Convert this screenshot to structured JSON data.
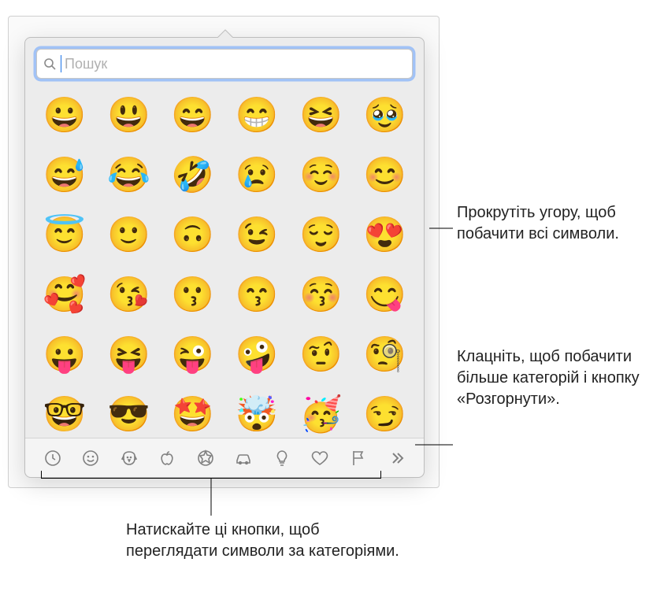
{
  "search": {
    "placeholder": "Пошук"
  },
  "emoji": {
    "rows": [
      [
        "😀",
        "😃",
        "😄",
        "😁",
        "😆",
        "🥹"
      ],
      [
        "😅",
        "😂",
        "🤣",
        "😢",
        "☺️",
        "😊"
      ],
      [
        "😇",
        "🙂",
        "🙃",
        "😉",
        "😌",
        "😍"
      ],
      [
        "🥰",
        "😘",
        "😗",
        "😙",
        "😚",
        "😋"
      ],
      [
        "😛",
        "😝",
        "😜",
        "🤪",
        "🤨",
        "🧐"
      ],
      [
        "🤓",
        "😎",
        "🤩",
        "🤯",
        "🥳",
        "😏"
      ]
    ]
  },
  "categories": [
    {
      "name": "recent",
      "icon": "clock"
    },
    {
      "name": "smileys",
      "icon": "smiley"
    },
    {
      "name": "animals",
      "icon": "dog"
    },
    {
      "name": "food",
      "icon": "apple"
    },
    {
      "name": "activity",
      "icon": "soccer"
    },
    {
      "name": "travel",
      "icon": "car"
    },
    {
      "name": "objects",
      "icon": "bulb"
    },
    {
      "name": "symbols",
      "icon": "heart"
    },
    {
      "name": "flags",
      "icon": "flag"
    },
    {
      "name": "more",
      "icon": "chevrons"
    }
  ],
  "callouts": {
    "scroll": "Прокрутіть угору, щоб побачити всі символи.",
    "expand": "Клацніть, щоб побачити більше категорій і кнопку «Розгорнути».",
    "categories": "Натискайте ці кнопки, щоб переглядати символи за категоріями."
  }
}
